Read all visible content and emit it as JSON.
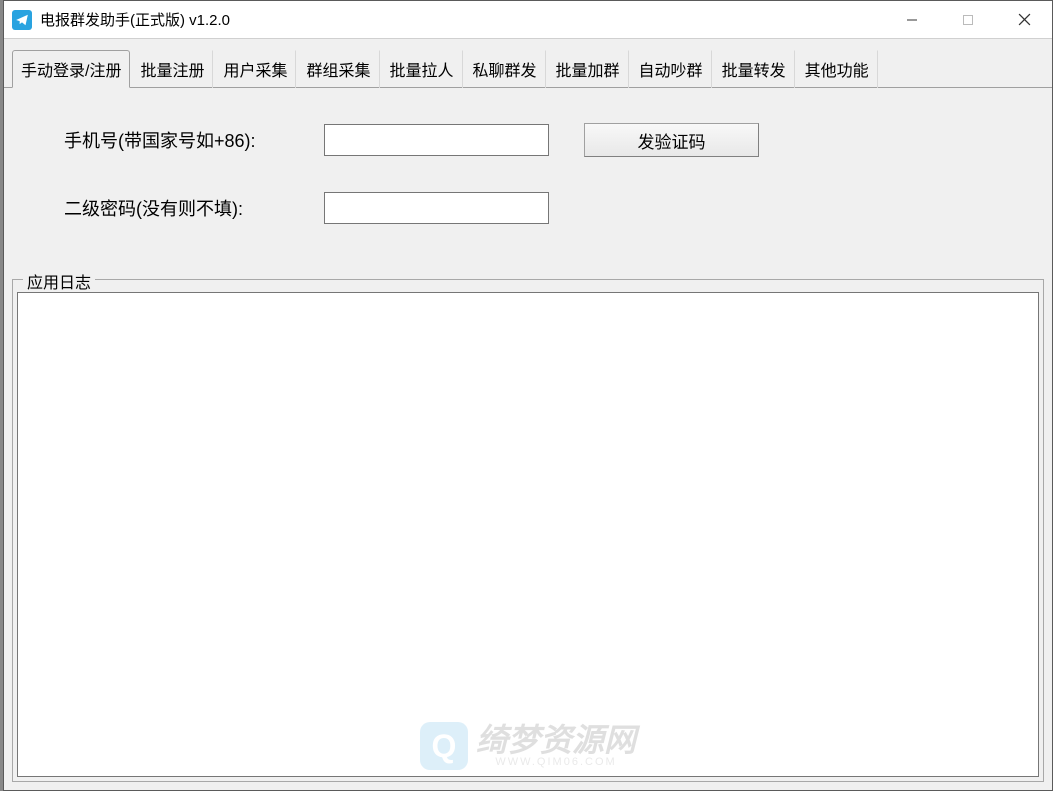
{
  "window": {
    "title": "电报群发助手(正式版) v1.2.0"
  },
  "tabs": [
    {
      "label": "手动登录/注册",
      "active": true
    },
    {
      "label": "批量注册",
      "active": false
    },
    {
      "label": "用户采集",
      "active": false
    },
    {
      "label": "群组采集",
      "active": false
    },
    {
      "label": "批量拉人",
      "active": false
    },
    {
      "label": "私聊群发",
      "active": false
    },
    {
      "label": "批量加群",
      "active": false
    },
    {
      "label": "自动吵群",
      "active": false
    },
    {
      "label": "批量转发",
      "active": false
    },
    {
      "label": "其他功能",
      "active": false
    }
  ],
  "form": {
    "phone_label": "手机号(带国家号如+86):",
    "phone_value": "",
    "send_code_button": "发验证码",
    "password_label": "二级密码(没有则不填):",
    "password_value": ""
  },
  "log": {
    "title": "应用日志",
    "content": ""
  },
  "watermark": {
    "logo_letter": "Q",
    "main_text": "绮梦资源网",
    "sub_text": "WWW.QIM06.COM"
  }
}
